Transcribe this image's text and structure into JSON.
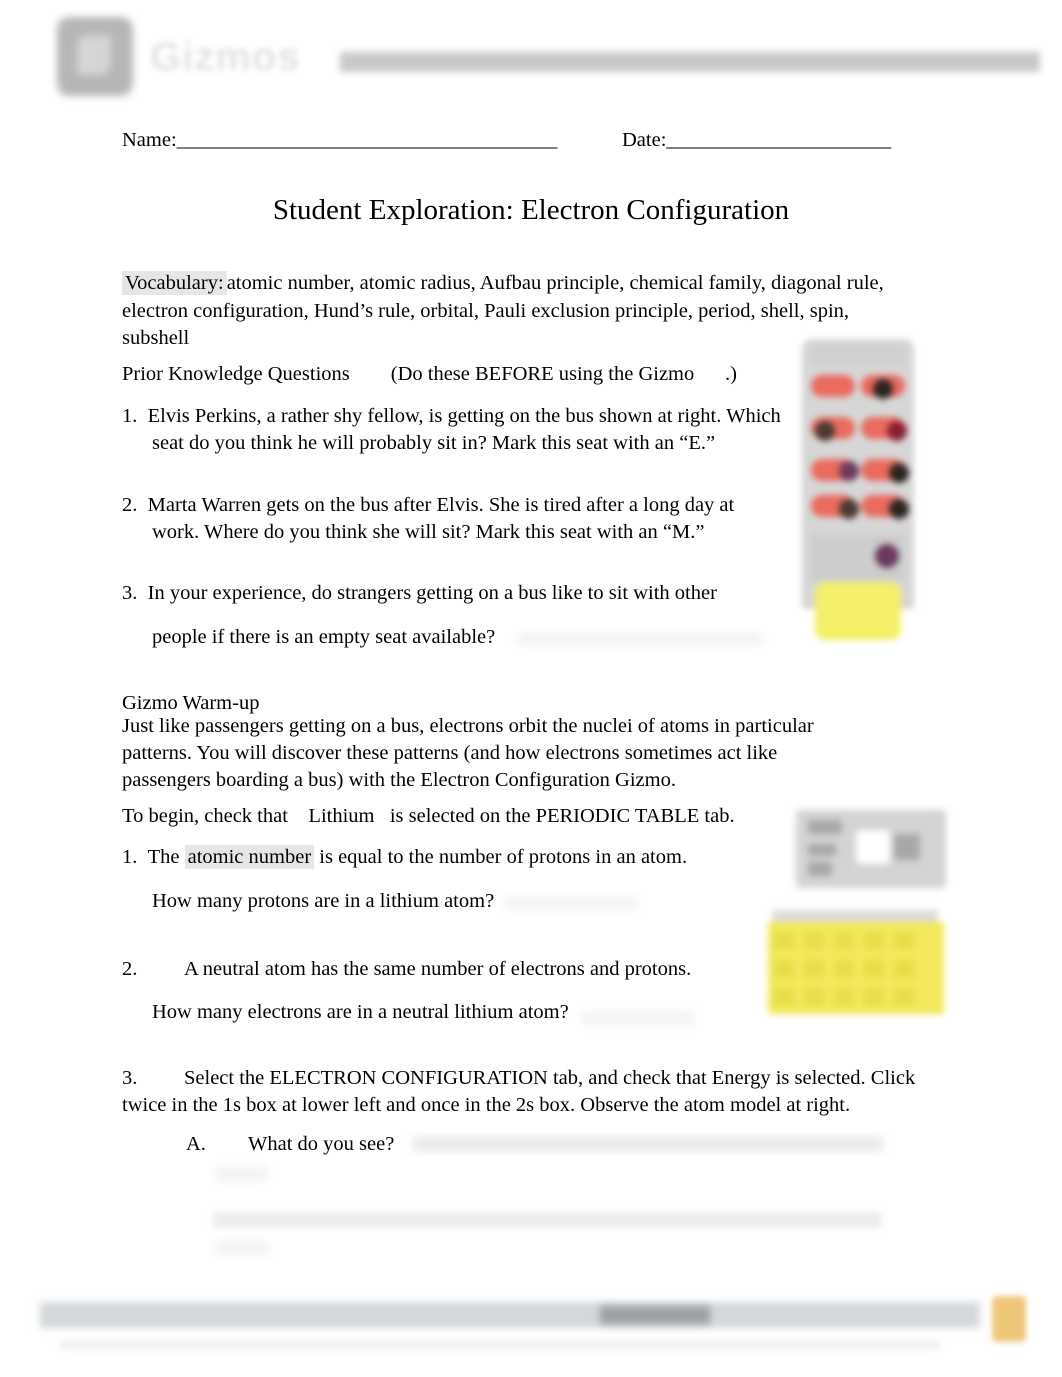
{
  "header": {
    "logo_wordmark": "Gizmos",
    "logo_icon": "gizmos-logo-icon"
  },
  "name_date": {
    "name_label": "Name:",
    "name_rule": "_______________________________________",
    "date_label": "Date:",
    "date_rule": "_______________________"
  },
  "title": "Student Exploration: Electron Configuration",
  "vocabulary": {
    "label": "Vocabulary:",
    "terms": "atomic number, atomic radius, Aufbau principle, chemical family, diagonal rule, electron configuration, Hund’s rule, orbital, Pauli exclusion principle, period, shell, spin, subshell"
  },
  "prior_knowledge": {
    "heading": "Prior Knowledge Questions        (Do these BEFORE using the Gizmo      .)",
    "questions": [
      {
        "number": "1.",
        "text": "Elvis Perkins, a rather shy fellow, is getting on the bus shown at right. Which seat do you think he will probably sit in? Mark this seat with an “E.”"
      },
      {
        "number": "2.",
        "text": "Marta Warren gets on the bus after Elvis. She is tired after a long day at work. Where do you think she will sit? Mark this seat with an “M.”"
      },
      {
        "number": "3.",
        "text": "In your experience, do strangers getting on a bus like to sit with other",
        "text_line2": "people if there is an empty seat available?"
      }
    ]
  },
  "warmup": {
    "heading": "Gizmo Warm-up",
    "body": "Just like passengers getting on a bus, electrons orbit the nuclei of atoms in particular patterns. You will discover these patterns (and how electrons sometimes act like passengers boarding a bus) with the  Electron Configuration   Gizmo.",
    "begin_line": "To begin, check that    Lithium   is selected on the PERIODIC TABLE tab.",
    "items": [
      {
        "number": "1.",
        "lead": "The ",
        "highlight": "atomic number",
        "rest": "  is equal to the number of protons in an atom.",
        "sub": "How many protons are in a lithium atom?"
      },
      {
        "number": "2.",
        "text": "A neutral atom has the same number of electrons and protons.",
        "sub": "How many electrons are in a neutral lithium atom?"
      },
      {
        "number": "3.",
        "text": "Select the ELECTRON CONFIGURATION tab, and check that        Energy   is selected. Click twice in the   1s  box at lower left and once in the     2s  box. Observe the atom model at right.",
        "sub_letter": "A.",
        "sub_text": "What do you see?"
      }
    ]
  },
  "images": {
    "bus_diagram": "bus-seating-diagram-image",
    "gizmo_periodic_table": "gizmo-periodic-table-screenshot"
  },
  "colors": {
    "highlight": "#e6e6e6",
    "seat": "#ea6a5e",
    "bus_front": "#f5f06a",
    "periodic_table": "#f2e95c",
    "footer_tab": "#efc77a"
  }
}
